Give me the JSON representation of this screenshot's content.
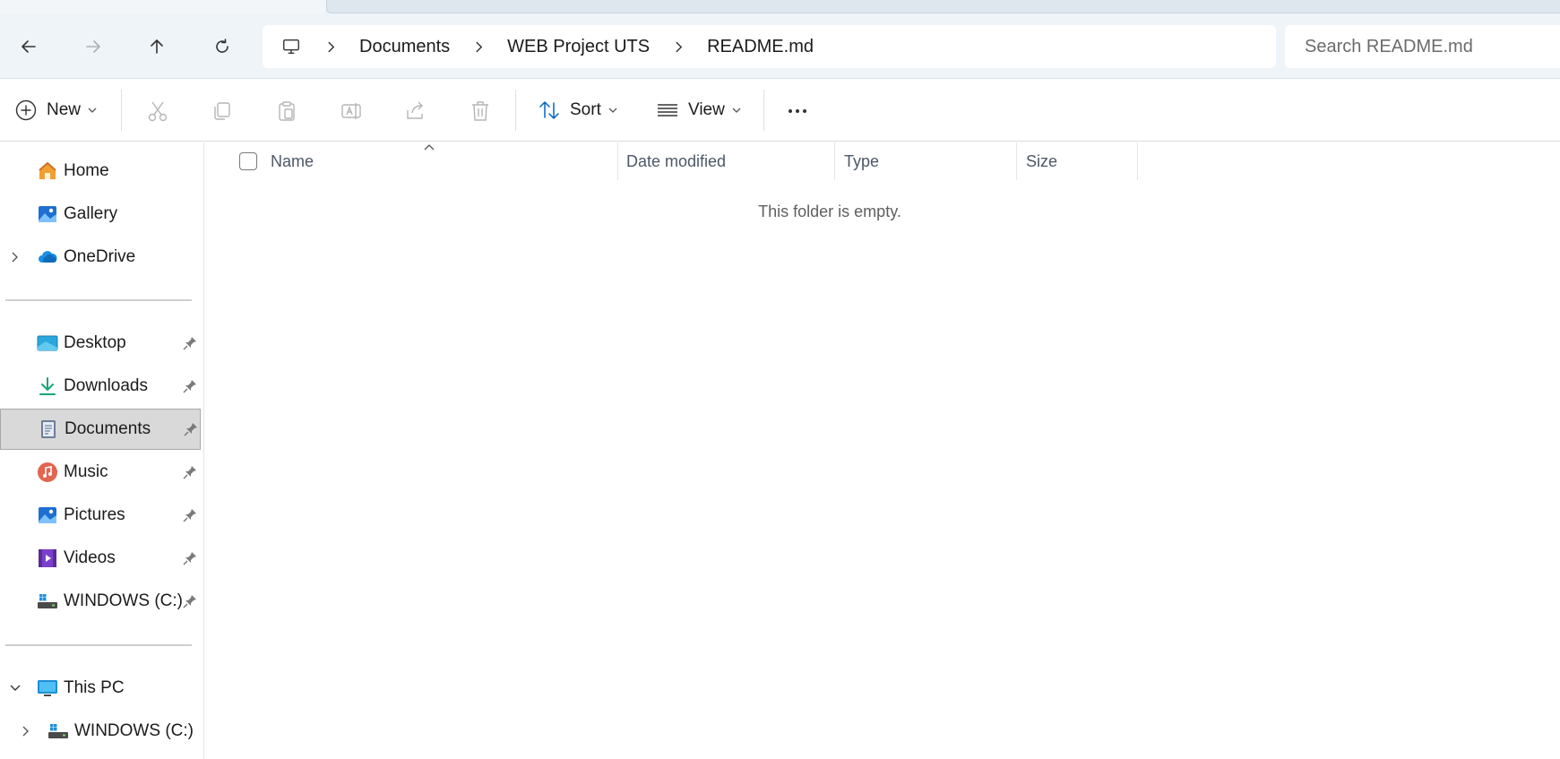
{
  "address_bar": {
    "breadcrumbs": [
      "Documents",
      "WEB Project UTS",
      "README.md"
    ],
    "search_placeholder": "Search README.md"
  },
  "toolbar": {
    "new_label": "New",
    "sort_label": "Sort",
    "view_label": "View"
  },
  "sidebar": {
    "home": "Home",
    "gallery": "Gallery",
    "onedrive": "OneDrive",
    "quick_access": [
      {
        "label": "Desktop",
        "icon": "desktop-icon"
      },
      {
        "label": "Downloads",
        "icon": "download-icon"
      },
      {
        "label": "Documents",
        "icon": "documents-icon",
        "selected": true
      },
      {
        "label": "Music",
        "icon": "music-icon"
      },
      {
        "label": "Pictures",
        "icon": "pictures-icon"
      },
      {
        "label": "Videos",
        "icon": "videos-icon"
      },
      {
        "label": "WINDOWS (C:)",
        "icon": "drive-icon"
      }
    ],
    "this_pc": "This PC",
    "this_pc_drive": "WINDOWS (C:)"
  },
  "file_list": {
    "columns": [
      "Name",
      "Date modified",
      "Type",
      "Size"
    ],
    "empty_message": "This folder is empty."
  },
  "colors": {
    "accent": "#0067c0",
    "address_bg": "#eff4f9",
    "selected_bg": "#d9d9d9"
  }
}
